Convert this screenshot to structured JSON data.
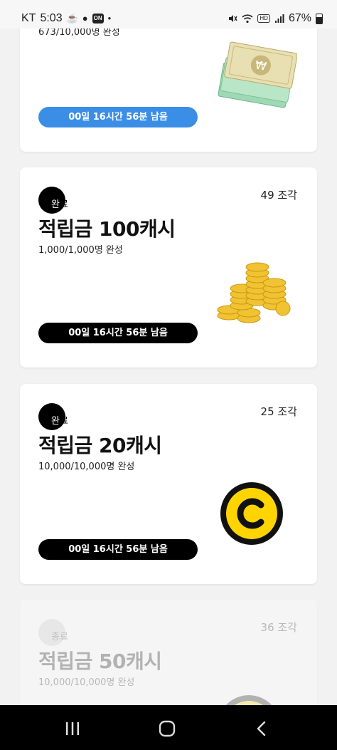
{
  "status_bar": {
    "carrier": "KT",
    "time": "5:03",
    "on_badge": "ON",
    "dot": "•",
    "hd_badge": "HD",
    "battery": "67%",
    "icons": [
      "cup-icon",
      "chat-bubble-icon",
      "mute-icon",
      "wifi-icon",
      "signal-icon",
      "battery-icon"
    ]
  },
  "cards": [
    {
      "progress": "673/10,000명 완성",
      "timer": "00일 16시간 56분 남음",
      "timer_color": "#3a8ee6",
      "image": "banknotes-icon"
    },
    {
      "status": "완료",
      "pieces": "49 조각",
      "title": "적립금 100캐시",
      "progress": "1,000/1,000명 완성",
      "timer": "00일 16시간 56분 남음",
      "image": "gold-coins-icon"
    },
    {
      "status": "완료",
      "pieces": "25 조각",
      "title": "적립금 20캐시",
      "progress": "10,000/10,000명 완성",
      "timer": "00일 16시간 56분 남음",
      "image": "cash-coin-icon"
    },
    {
      "status": "종료",
      "pieces": "36 조각",
      "title": "적립금 50캐시",
      "progress": "10,000/10,000명 완성",
      "image": "cash-coin-icon"
    }
  ],
  "nav_bar": {
    "buttons": [
      "recent-apps-icon",
      "home-icon",
      "back-icon"
    ]
  },
  "colors": {
    "accent_blue": "#3a8ee6",
    "coin_yellow": "#ffd400",
    "background": "#f2f2f2"
  }
}
